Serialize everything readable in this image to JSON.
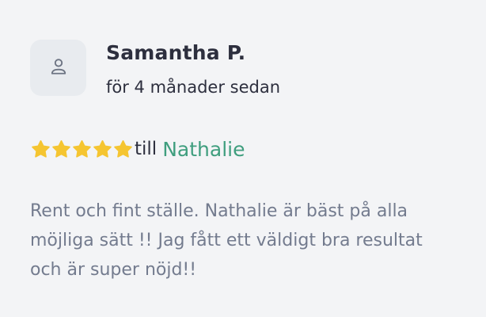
{
  "review": {
    "author": {
      "avatar_icon": "user-icon",
      "name": "Samantha P."
    },
    "date": "för 4 månader sedan",
    "rating": {
      "stars": 5,
      "max_stars": 5,
      "star_icon": "star-icon",
      "star_color": "#f5c531",
      "prefix": "till",
      "target": "Nathalie",
      "target_color": "#3f9e7e"
    },
    "text": "Rent och fint ställe. Nathalie är bäst på alla möjliga sätt !! Jag fått ett väldigt bra resultat och är super nöjd!!"
  }
}
